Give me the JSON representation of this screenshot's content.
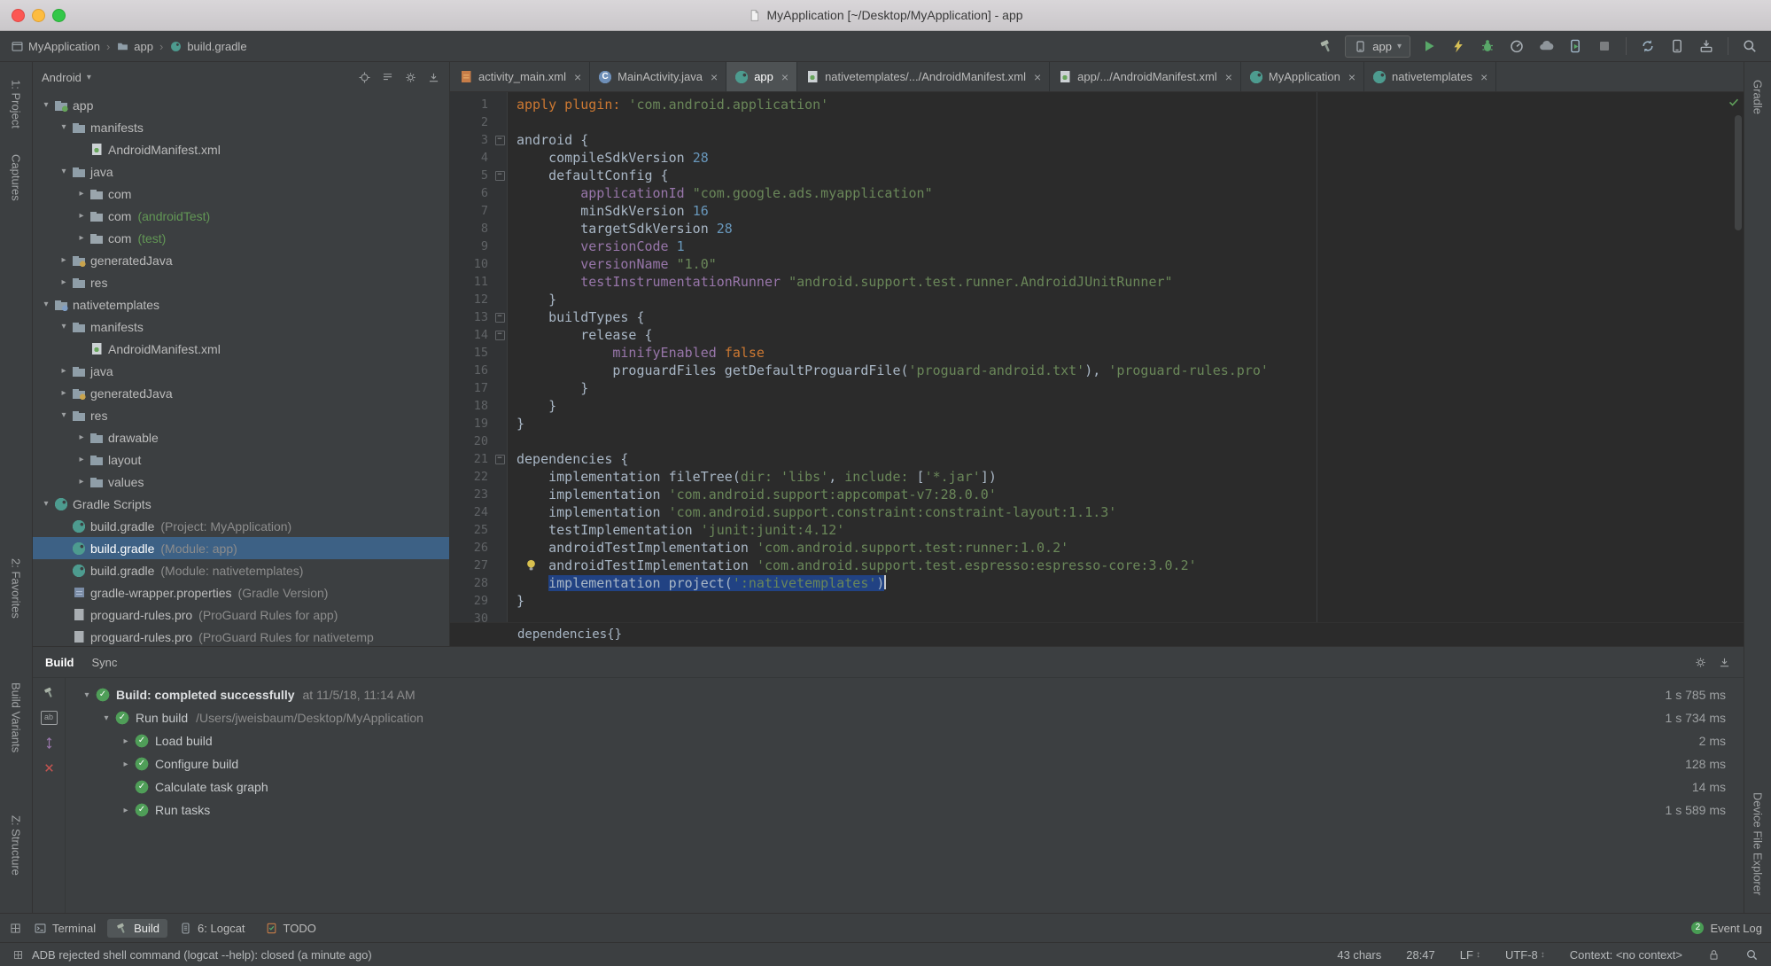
{
  "window": {
    "title": "MyApplication [~/Desktop/MyApplication] - app"
  },
  "navbar": {
    "breadcrumbs": [
      {
        "label": "MyApplication",
        "icon": "window"
      },
      {
        "label": "app",
        "icon": "folder"
      },
      {
        "label": "build.gradle",
        "icon": "gradle"
      }
    ],
    "run_config": "app",
    "toolbar_icons_left": [
      "hammer"
    ],
    "toolbar_icons_right": [
      "run",
      "apply-changes",
      "debug",
      "profiler",
      "cloud",
      "device-run",
      "stop",
      "sep",
      "sync",
      "avd",
      "sdk",
      "sep",
      "search"
    ]
  },
  "tool_strips": {
    "left": [
      "1: Project",
      "Captures",
      "2: Favorites",
      "Build Variants",
      "Z: Structure"
    ],
    "right": [
      "Gradle",
      "Device File Explorer"
    ]
  },
  "project_panel": {
    "selector": "Android",
    "tree": [
      {
        "indent": 0,
        "arrow": "down",
        "icon": "app-module",
        "label": "app"
      },
      {
        "indent": 1,
        "arrow": "down",
        "icon": "folder",
        "label": "manifests"
      },
      {
        "indent": 2,
        "arrow": "",
        "icon": "manifest",
        "label": "AndroidManifest.xml"
      },
      {
        "indent": 1,
        "arrow": "down",
        "icon": "folder",
        "label": "java"
      },
      {
        "indent": 2,
        "arrow": "right",
        "icon": "package",
        "label": "com"
      },
      {
        "indent": 2,
        "arrow": "right",
        "icon": "package",
        "label": "com",
        "annotation": "(androidTest)",
        "ann_style": "green"
      },
      {
        "indent": 2,
        "arrow": "right",
        "icon": "package",
        "label": "com",
        "annotation": "(test)",
        "ann_style": "green"
      },
      {
        "indent": 1,
        "arrow": "right",
        "icon": "gen-folder",
        "label": "generatedJava"
      },
      {
        "indent": 1,
        "arrow": "right",
        "icon": "folder",
        "label": "res"
      },
      {
        "indent": 0,
        "arrow": "down",
        "icon": "module",
        "label": "nativetemplates"
      },
      {
        "indent": 1,
        "arrow": "down",
        "icon": "folder",
        "label": "manifests"
      },
      {
        "indent": 2,
        "arrow": "",
        "icon": "manifest",
        "label": "AndroidManifest.xml"
      },
      {
        "indent": 1,
        "arrow": "right",
        "icon": "folder",
        "label": "java"
      },
      {
        "indent": 1,
        "arrow": "right",
        "icon": "gen-folder",
        "label": "generatedJava"
      },
      {
        "indent": 1,
        "arrow": "down",
        "icon": "folder",
        "label": "res"
      },
      {
        "indent": 2,
        "arrow": "right",
        "icon": "folder",
        "label": "drawable"
      },
      {
        "indent": 2,
        "arrow": "right",
        "icon": "folder",
        "label": "layout"
      },
      {
        "indent": 2,
        "arrow": "right",
        "icon": "folder",
        "label": "values"
      },
      {
        "indent": 0,
        "arrow": "down",
        "icon": "gradle",
        "label": "Gradle Scripts"
      },
      {
        "indent": 1,
        "arrow": "",
        "icon": "gradle",
        "label": "build.gradle",
        "annotation": "(Project: MyApplication)"
      },
      {
        "indent": 1,
        "arrow": "",
        "icon": "gradle",
        "label": "build.gradle",
        "annotation": "(Module: app)",
        "selected": true
      },
      {
        "indent": 1,
        "arrow": "",
        "icon": "gradle",
        "label": "build.gradle",
        "annotation": "(Module: nativetemplates)"
      },
      {
        "indent": 1,
        "arrow": "",
        "icon": "properties",
        "label": "gradle-wrapper.properties",
        "annotation": "(Gradle Version)"
      },
      {
        "indent": 1,
        "arrow": "",
        "icon": "proguard",
        "label": "proguard-rules.pro",
        "annotation": "(ProGuard Rules for app)"
      },
      {
        "indent": 1,
        "arrow": "",
        "icon": "proguard",
        "label": "proguard-rules.pro",
        "annotation": "(ProGuard Rules for nativetemp"
      }
    ]
  },
  "editor": {
    "tabs": [
      {
        "label": "activity_main.xml",
        "icon": "layout"
      },
      {
        "label": "MainActivity.java",
        "icon": "class"
      },
      {
        "label": "app",
        "icon": "gradle",
        "active": true
      },
      {
        "label": "nativetemplates/.../AndroidManifest.xml",
        "icon": "manifest"
      },
      {
        "label": "app/.../AndroidManifest.xml",
        "icon": "manifest"
      },
      {
        "label": "MyApplication",
        "icon": "gradle"
      },
      {
        "label": "nativetemplates",
        "icon": "gradle"
      }
    ],
    "breadcrumb": "dependencies{}",
    "lines": [
      {
        "n": 1,
        "t": [
          [
            "k",
            "apply plugin: "
          ],
          [
            "s",
            "'com.android.application'"
          ]
        ]
      },
      {
        "n": 2,
        "t": []
      },
      {
        "n": 3,
        "t": [
          [
            "p",
            "android {"
          ]
        ],
        "fold": 1
      },
      {
        "n": 4,
        "t": [
          [
            "p",
            "    compileSdkVersion "
          ],
          [
            "n",
            "28"
          ]
        ]
      },
      {
        "n": 5,
        "t": [
          [
            "p",
            "    defaultConfig {"
          ]
        ],
        "fold": 1
      },
      {
        "n": 6,
        "t": [
          [
            "p",
            "        "
          ],
          [
            "f",
            "applicationId"
          ],
          [
            "p",
            " "
          ],
          [
            "s",
            "\"com.google.ads.myapplication\""
          ]
        ]
      },
      {
        "n": 7,
        "t": [
          [
            "p",
            "        minSdkVersion "
          ],
          [
            "n",
            "16"
          ]
        ]
      },
      {
        "n": 8,
        "t": [
          [
            "p",
            "        targetSdkVersion "
          ],
          [
            "n",
            "28"
          ]
        ]
      },
      {
        "n": 9,
        "t": [
          [
            "p",
            "        "
          ],
          [
            "f",
            "versionCode"
          ],
          [
            "p",
            " "
          ],
          [
            "n",
            "1"
          ]
        ]
      },
      {
        "n": 10,
        "t": [
          [
            "p",
            "        "
          ],
          [
            "f",
            "versionName"
          ],
          [
            "p",
            " "
          ],
          [
            "s",
            "\"1.0\""
          ]
        ]
      },
      {
        "n": 11,
        "t": [
          [
            "p",
            "        "
          ],
          [
            "f",
            "testInstrumentationRunner"
          ],
          [
            "p",
            " "
          ],
          [
            "s",
            "\"android.support.test.runner.AndroidJUnitRunner\""
          ]
        ]
      },
      {
        "n": 12,
        "t": [
          [
            "p",
            "    }"
          ]
        ]
      },
      {
        "n": 13,
        "t": [
          [
            "p",
            "    buildTypes {"
          ]
        ],
        "fold": 1
      },
      {
        "n": 14,
        "t": [
          [
            "p",
            "        release {"
          ]
        ],
        "fold": 1
      },
      {
        "n": 15,
        "t": [
          [
            "p",
            "            "
          ],
          [
            "f",
            "minifyEnabled"
          ],
          [
            "p",
            " "
          ],
          [
            "k",
            "false"
          ]
        ]
      },
      {
        "n": 16,
        "t": [
          [
            "p",
            "            proguardFiles getDefaultProguardFile("
          ],
          [
            "s",
            "'proguard-android.txt'"
          ],
          [
            "p",
            "), "
          ],
          [
            "s",
            "'proguard-rules.pro'"
          ]
        ]
      },
      {
        "n": 17,
        "t": [
          [
            "p",
            "        }"
          ]
        ]
      },
      {
        "n": 18,
        "t": [
          [
            "p",
            "    }"
          ]
        ]
      },
      {
        "n": 19,
        "t": [
          [
            "p",
            "}"
          ]
        ]
      },
      {
        "n": 20,
        "t": []
      },
      {
        "n": 21,
        "t": [
          [
            "p",
            "dependencies {"
          ]
        ],
        "fold": 1
      },
      {
        "n": 22,
        "t": [
          [
            "p",
            "    implementation fileTree("
          ],
          [
            "m",
            "dir:"
          ],
          [
            "p",
            " "
          ],
          [
            "s",
            "'libs'"
          ],
          [
            "p",
            ", "
          ],
          [
            "m",
            "include:"
          ],
          [
            "p",
            " ["
          ],
          [
            "s",
            "'*.jar'"
          ],
          [
            "p",
            "])"
          ]
        ]
      },
      {
        "n": 23,
        "t": [
          [
            "p",
            "    implementation "
          ],
          [
            "s",
            "'com.android.support:appcompat-v7:28.0.0'"
          ]
        ]
      },
      {
        "n": 24,
        "t": [
          [
            "p",
            "    implementation "
          ],
          [
            "s",
            "'com.android.support.constraint:constraint-layout:1.1.3'"
          ]
        ]
      },
      {
        "n": 25,
        "t": [
          [
            "p",
            "    testImplementation "
          ],
          [
            "s",
            "'junit:junit:4.12'"
          ]
        ]
      },
      {
        "n": 26,
        "t": [
          [
            "p",
            "    androidTestImplementation "
          ],
          [
            "s",
            "'com.android.support.test:runner:1.0.2'"
          ]
        ]
      },
      {
        "n": 27,
        "t": [
          [
            "p",
            "    androidTestImplementation "
          ],
          [
            "s",
            "'com.android.support.test.espresso:espresso-core:3.0.2'"
          ]
        ],
        "bulb": 1
      },
      {
        "n": 28,
        "t": [
          [
            "p",
            "    "
          ],
          [
            "p",
            "implementation project(",
            1
          ],
          [
            "s",
            "':nativetemplates'",
            1
          ],
          [
            "p",
            ")",
            1
          ]
        ],
        "caret": 1
      },
      {
        "n": 29,
        "t": [
          [
            "p",
            "}"
          ]
        ]
      },
      {
        "n": 30,
        "t": []
      }
    ]
  },
  "build_panel": {
    "tabs": [
      {
        "label": "Build",
        "active": true
      },
      {
        "label": "Sync"
      }
    ],
    "rows": [
      {
        "indent": 0,
        "arrow": "down",
        "title": "Build: completed successfully",
        "bold": true,
        "detail": "at 11/5/18, 11:14 AM",
        "time": "1 s 785 ms"
      },
      {
        "indent": 1,
        "arrow": "down",
        "title": "Run build",
        "detail": "/Users/jweisbaum/Desktop/MyApplication",
        "time": "1 s 734 ms"
      },
      {
        "indent": 2,
        "arrow": "right",
        "title": "Load build",
        "time": "2 ms"
      },
      {
        "indent": 2,
        "arrow": "right",
        "title": "Configure build",
        "time": "128 ms"
      },
      {
        "indent": 2,
        "arrow": "",
        "title": "Calculate task graph",
        "time": "14 ms"
      },
      {
        "indent": 2,
        "arrow": "right",
        "title": "Run tasks",
        "time": "1 s 589 ms"
      }
    ]
  },
  "bottom_bar": {
    "tabs": [
      {
        "label": "Terminal",
        "icon": "terminal"
      },
      {
        "label": "Build",
        "icon": "hammer",
        "active": true
      },
      {
        "label": "6: Logcat",
        "icon": "logcat"
      },
      {
        "label": "TODO",
        "icon": "todo"
      }
    ],
    "event_log": {
      "label": "Event Log",
      "badge": "2"
    }
  },
  "status_bar": {
    "message": "ADB rejected shell command (logcat --help): closed (a minute ago)",
    "chars": "43 chars",
    "position": "28:47",
    "line_sep": "LF",
    "encoding": "UTF-8",
    "context": "Context: <no context>"
  },
  "colors": {
    "accent_selection": "#3d6185",
    "editor_selection": "#214283",
    "success_green": "#499c54",
    "gradle_teal": "#4d9b8f"
  }
}
